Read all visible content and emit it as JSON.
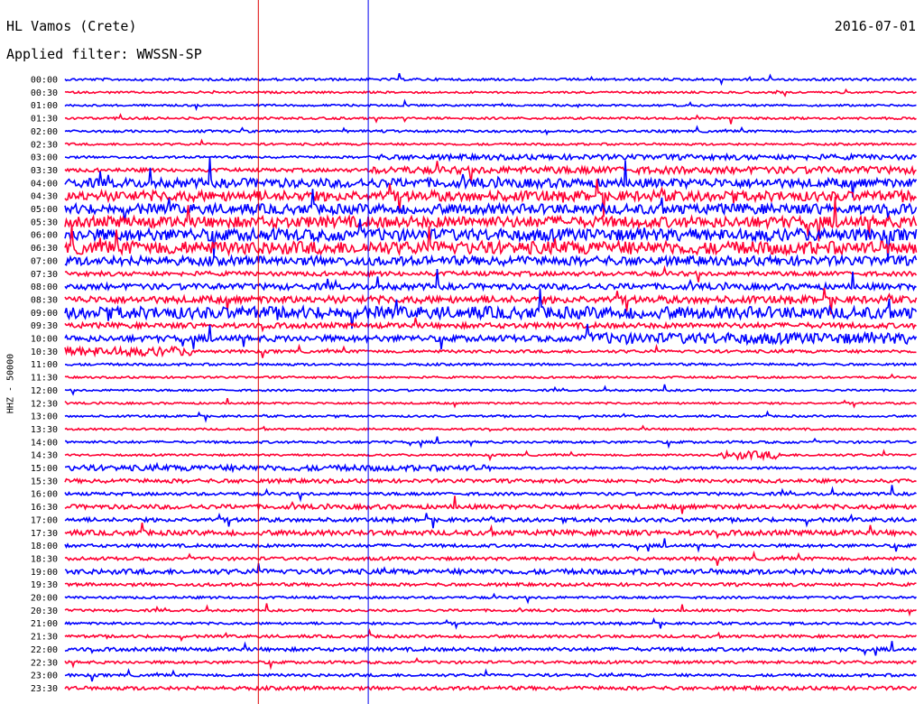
{
  "header": {
    "station": "HL Vamos (Crete)",
    "date": "2016-07-01",
    "filter": "Applied filter: WWSSN-SP"
  },
  "channel_label": "HHZ - 50000",
  "colors": {
    "trace_a": "#0000ff",
    "trace_b": "#ff0033",
    "marker_red": "#dd0000",
    "marker_blue": "#0000ee",
    "background": "#ffffff"
  },
  "chart_data": {
    "type": "helicorder",
    "title": "HL Vamos (Crete)",
    "date": "2016-07-01",
    "filter": "WWSSN-SP",
    "channel": "HHZ",
    "scale": 50000,
    "row_interval_minutes": 30,
    "color_cycle": [
      "blue",
      "red"
    ],
    "rows": [
      {
        "time": "00:00",
        "color": "blue",
        "activity": [
          [
            0,
            1,
            1.2
          ]
        ]
      },
      {
        "time": "00:30",
        "color": "red",
        "activity": [
          [
            0,
            1,
            1.0
          ]
        ]
      },
      {
        "time": "01:00",
        "color": "blue",
        "activity": [
          [
            0,
            1,
            1.0
          ]
        ]
      },
      {
        "time": "01:30",
        "color": "red",
        "activity": [
          [
            0,
            1,
            1.1
          ]
        ]
      },
      {
        "time": "02:00",
        "color": "blue",
        "activity": [
          [
            0,
            1,
            1.2
          ]
        ]
      },
      {
        "time": "02:30",
        "color": "red",
        "activity": [
          [
            0,
            1,
            1.1
          ]
        ]
      },
      {
        "time": "03:00",
        "color": "blue",
        "activity": [
          [
            0,
            0.36,
            1.2
          ],
          [
            0.36,
            1,
            2.6
          ]
        ]
      },
      {
        "time": "03:30",
        "color": "red",
        "activity": [
          [
            0,
            0.36,
            1.8
          ],
          [
            0.36,
            1,
            3.5
          ]
        ]
      },
      {
        "time": "04:00",
        "color": "blue",
        "activity": [
          [
            0,
            1,
            4.5
          ]
        ]
      },
      {
        "time": "04:30",
        "color": "red",
        "activity": [
          [
            0,
            1,
            5.0
          ]
        ]
      },
      {
        "time": "05:00",
        "color": "blue",
        "activity": [
          [
            0,
            1,
            5.0
          ]
        ]
      },
      {
        "time": "05:30",
        "color": "red",
        "activity": [
          [
            0,
            1,
            5.5
          ]
        ]
      },
      {
        "time": "06:00",
        "color": "blue",
        "activity": [
          [
            0,
            1,
            6.0
          ]
        ]
      },
      {
        "time": "06:30",
        "color": "red",
        "activity": [
          [
            0,
            1,
            6.5
          ]
        ]
      },
      {
        "time": "07:00",
        "color": "blue",
        "activity": [
          [
            0,
            1,
            4.5
          ]
        ]
      },
      {
        "time": "07:30",
        "color": "red",
        "activity": [
          [
            0,
            1,
            2.2
          ]
        ]
      },
      {
        "time": "08:00",
        "color": "blue",
        "activity": [
          [
            0,
            1,
            3.0
          ]
        ]
      },
      {
        "time": "08:30",
        "color": "red",
        "activity": [
          [
            0,
            1,
            3.5
          ]
        ]
      },
      {
        "time": "09:00",
        "color": "blue",
        "activity": [
          [
            0,
            1,
            6.0
          ]
        ]
      },
      {
        "time": "09:30",
        "color": "red",
        "activity": [
          [
            0,
            1,
            2.6
          ]
        ]
      },
      {
        "time": "10:00",
        "color": "blue",
        "activity": [
          [
            0,
            0.6,
            3.0
          ],
          [
            0.6,
            1,
            5.5
          ]
        ]
      },
      {
        "time": "10:30",
        "color": "red",
        "activity": [
          [
            0,
            0.15,
            4.5
          ],
          [
            0.15,
            1,
            1.5
          ]
        ]
      },
      {
        "time": "11:00",
        "color": "blue",
        "activity": [
          [
            0,
            1,
            1.2
          ]
        ]
      },
      {
        "time": "11:30",
        "color": "red",
        "activity": [
          [
            0,
            1,
            1.0
          ]
        ]
      },
      {
        "time": "12:00",
        "color": "blue",
        "activity": [
          [
            0,
            1,
            1.0
          ]
        ]
      },
      {
        "time": "12:30",
        "color": "red",
        "activity": [
          [
            0,
            1,
            1.0
          ]
        ]
      },
      {
        "time": "13:00",
        "color": "blue",
        "activity": [
          [
            0,
            1,
            1.0
          ]
        ]
      },
      {
        "time": "13:30",
        "color": "red",
        "activity": [
          [
            0,
            1,
            1.0
          ]
        ]
      },
      {
        "time": "14:00",
        "color": "blue",
        "activity": [
          [
            0,
            1,
            1.2
          ]
        ]
      },
      {
        "time": "14:30",
        "color": "red",
        "activity": [
          [
            0,
            0.77,
            1.0
          ],
          [
            0.77,
            0.84,
            4.0
          ],
          [
            0.84,
            1,
            1.2
          ]
        ]
      },
      {
        "time": "15:00",
        "color": "blue",
        "activity": [
          [
            0,
            0.5,
            2.8
          ],
          [
            0.5,
            1,
            1.2
          ]
        ]
      },
      {
        "time": "15:30",
        "color": "red",
        "activity": [
          [
            0,
            0.33,
            2.0
          ],
          [
            0.33,
            1,
            1.8
          ]
        ]
      },
      {
        "time": "16:00",
        "color": "blue",
        "activity": [
          [
            0,
            1,
            1.5
          ]
        ]
      },
      {
        "time": "16:30",
        "color": "red",
        "activity": [
          [
            0,
            1,
            2.2
          ]
        ]
      },
      {
        "time": "17:00",
        "color": "blue",
        "activity": [
          [
            0,
            1,
            2.0
          ]
        ]
      },
      {
        "time": "17:30",
        "color": "red",
        "activity": [
          [
            0,
            1,
            2.5
          ]
        ]
      },
      {
        "time": "18:00",
        "color": "blue",
        "activity": [
          [
            0,
            1,
            1.6
          ]
        ]
      },
      {
        "time": "18:30",
        "color": "red",
        "activity": [
          [
            0,
            1,
            1.6
          ]
        ]
      },
      {
        "time": "19:00",
        "color": "blue",
        "activity": [
          [
            0,
            1,
            2.5
          ]
        ]
      },
      {
        "time": "19:30",
        "color": "red",
        "activity": [
          [
            0,
            1,
            1.6
          ]
        ]
      },
      {
        "time": "20:00",
        "color": "blue",
        "activity": [
          [
            0,
            1,
            1.2
          ]
        ]
      },
      {
        "time": "20:30",
        "color": "red",
        "activity": [
          [
            0,
            1,
            1.2
          ]
        ]
      },
      {
        "time": "21:00",
        "color": "blue",
        "activity": [
          [
            0,
            1,
            1.2
          ]
        ]
      },
      {
        "time": "21:30",
        "color": "red",
        "activity": [
          [
            0,
            1,
            1.4
          ]
        ]
      },
      {
        "time": "22:00",
        "color": "blue",
        "activity": [
          [
            0,
            1,
            1.8
          ]
        ]
      },
      {
        "time": "22:30",
        "color": "red",
        "activity": [
          [
            0,
            1,
            1.4
          ]
        ]
      },
      {
        "time": "23:00",
        "color": "blue",
        "activity": [
          [
            0,
            1,
            1.4
          ]
        ]
      },
      {
        "time": "23:30",
        "color": "red",
        "activity": [
          [
            0,
            1,
            1.8
          ]
        ]
      }
    ],
    "vertical_markers": [
      {
        "color": "red",
        "position_fraction": 0.227
      },
      {
        "color": "blue",
        "position_fraction": 0.356
      }
    ]
  }
}
